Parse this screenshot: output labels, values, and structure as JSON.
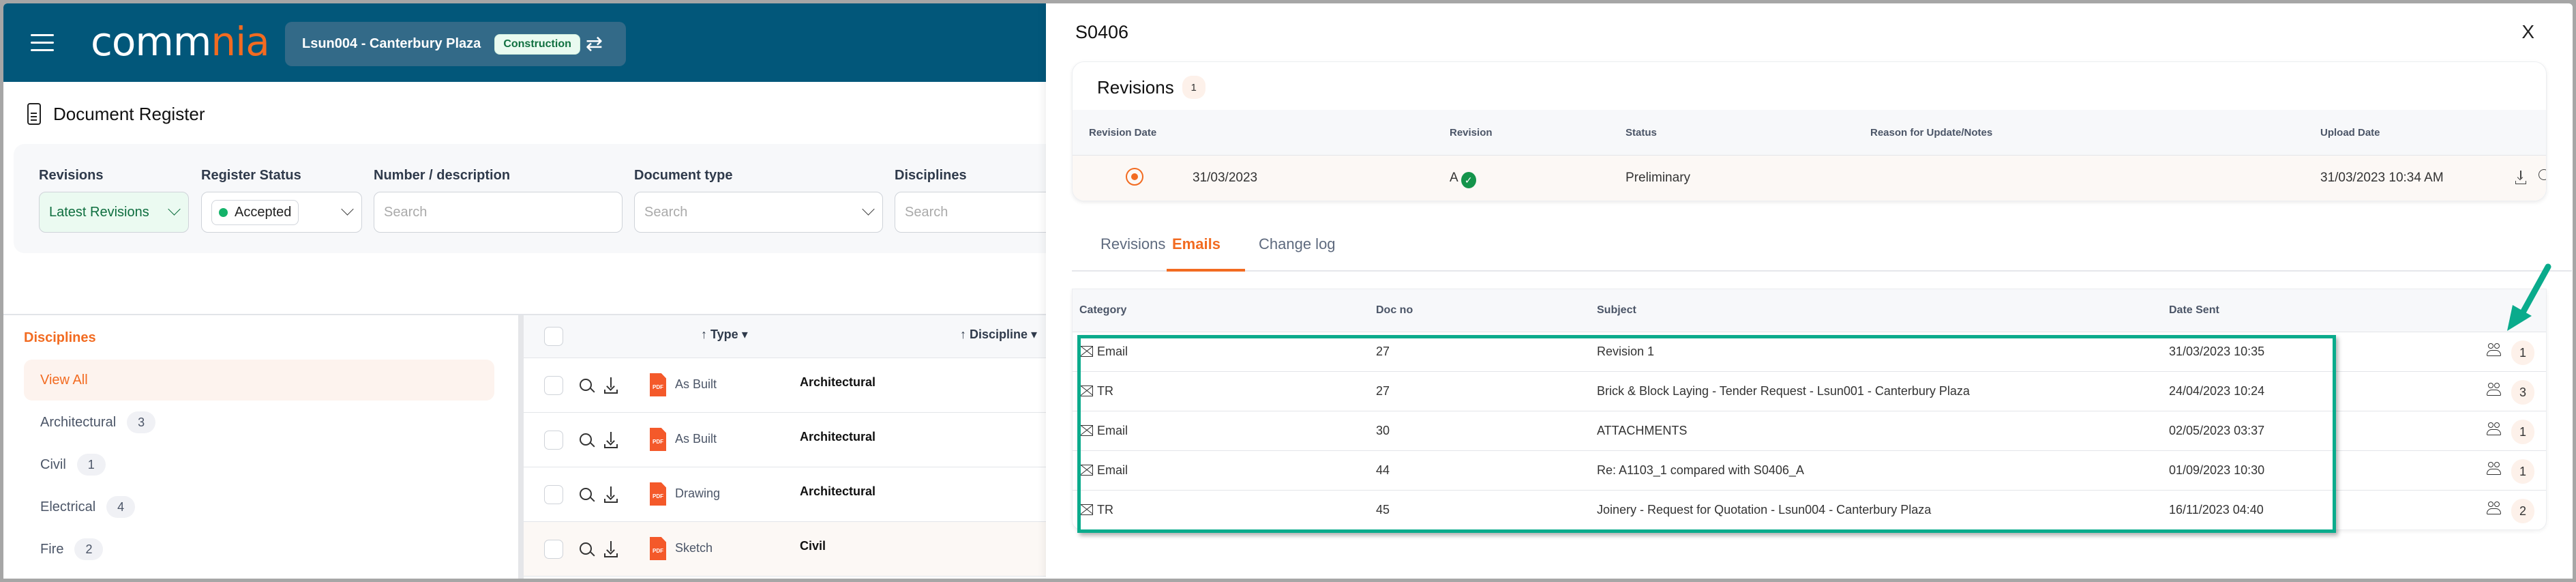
{
  "app": {
    "logo_text_white": "comm",
    "logo_text_orange": "nia",
    "project": {
      "name": "Lsun004 - Canterbury Plaza",
      "phase": "Construction"
    },
    "page_title": "Document Register"
  },
  "filters": {
    "revisions": {
      "label": "Revisions",
      "value": "Latest Revisions"
    },
    "register_status": {
      "label": "Register Status",
      "value": "Accepted"
    },
    "number_description": {
      "label": "Number / description",
      "placeholder": "Search"
    },
    "document_type": {
      "label": "Document type",
      "placeholder": "Search"
    },
    "disciplines": {
      "label": "Disciplines",
      "placeholder": "Search"
    }
  },
  "sidebar": {
    "title": "Disciplines",
    "items": [
      {
        "label": "View All",
        "count": null,
        "active": true
      },
      {
        "label": "Architectural",
        "count": "3"
      },
      {
        "label": "Civil",
        "count": "1"
      },
      {
        "label": "Electrical",
        "count": "4"
      },
      {
        "label": "Fire",
        "count": "2"
      }
    ]
  },
  "doc_table": {
    "columns": {
      "type": "Type",
      "discipline": "Discipline"
    },
    "rows": [
      {
        "file_icon": "PDF",
        "type": "As Built",
        "discipline": "Architectural"
      },
      {
        "file_icon": "PDF",
        "type": "As Built",
        "discipline": "Architectural"
      },
      {
        "file_icon": "PDF",
        "type": "Drawing",
        "discipline": "Architectural"
      },
      {
        "file_icon": "PDF",
        "type": "Sketch",
        "discipline": "Civil"
      }
    ]
  },
  "panel": {
    "title": "S0406",
    "close": "X",
    "revisions_card": {
      "title": "Revisions",
      "count": "1",
      "columns": [
        "Revision Date",
        "Revision",
        "Status",
        "Reason for Update/Notes",
        "Upload Date"
      ],
      "rows": [
        {
          "revision_date": "31/03/2023",
          "revision": "A",
          "status": "Preliminary",
          "notes": "",
          "upload_date": "31/03/2023 10:34 AM"
        }
      ]
    },
    "tabs": [
      {
        "label": "Revisions",
        "active": false
      },
      {
        "label": "Emails",
        "active": true
      },
      {
        "label": "Change log",
        "active": false
      }
    ],
    "emails": {
      "columns": [
        "Category",
        "Doc no",
        "Subject",
        "Date Sent"
      ],
      "rows": [
        {
          "category": "Email",
          "doc_no": "27",
          "subject": "Revision 1",
          "date_sent": "31/03/2023 10:35",
          "recipients": "1"
        },
        {
          "category": "TR",
          "doc_no": "27",
          "subject": "Brick & Block Laying - Tender Request - Lsun001 - Canterbury Plaza",
          "date_sent": "24/04/2023 10:24",
          "recipients": "3"
        },
        {
          "category": "Email",
          "doc_no": "30",
          "subject": "ATTACHMENTS",
          "date_sent": "02/05/2023 03:37",
          "recipients": "1"
        },
        {
          "category": "Email",
          "doc_no": "44",
          "subject": "Re: A1103_1 compared with S0406_A",
          "date_sent": "01/09/2023 10:30",
          "recipients": "1"
        },
        {
          "category": "TR",
          "doc_no": "45",
          "subject": "Joinery - Request for Quotation - Lsun004 - Canterbury Plaza",
          "date_sent": "16/11/2023 04:40",
          "recipients": "2"
        }
      ]
    }
  },
  "colors": {
    "header": "#02577a",
    "accent_orange": "#f26b21",
    "annotation_teal": "#0aab8c",
    "success_green": "#14944b"
  }
}
